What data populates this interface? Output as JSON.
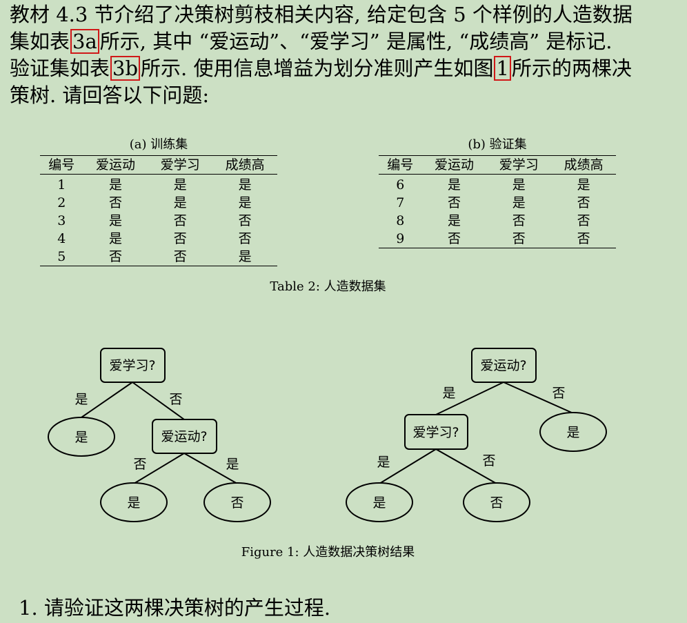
{
  "intro": {
    "line1": "教材 4.3 节介绍了决策树剪枝相关内容, 给定包含 5 个样例的人造数据",
    "line2_pre": "集如表",
    "ref_table_a": "3a",
    "line2_post": "所示, 其中 “爱运动”、“爱学习” 是属性, “成绩高” 是标记.",
    "line3_pre": "验证集如表",
    "ref_table_b": "3b",
    "line3_mid": "所示. 使用信息增益为划分准则产生如图",
    "ref_figure": "1",
    "line3_post": "所示的两棵决",
    "line4": "策树. 请回答以下问题:"
  },
  "table_a": {
    "caption": "(a) 训练集",
    "headers": [
      "编号",
      "爱运动",
      "爱学习",
      "成绩高"
    ],
    "rows": [
      [
        "1",
        "是",
        "是",
        "是"
      ],
      [
        "2",
        "否",
        "是",
        "是"
      ],
      [
        "3",
        "是",
        "否",
        "否"
      ],
      [
        "4",
        "是",
        "否",
        "否"
      ],
      [
        "5",
        "否",
        "否",
        "是"
      ]
    ]
  },
  "table_b": {
    "caption": "(b) 验证集",
    "headers": [
      "编号",
      "爱运动",
      "爱学习",
      "成绩高"
    ],
    "rows": [
      [
        "6",
        "是",
        "是",
        "是"
      ],
      [
        "7",
        "否",
        "是",
        "否"
      ],
      [
        "8",
        "是",
        "否",
        "否"
      ],
      [
        "9",
        "否",
        "否",
        "否"
      ]
    ]
  },
  "table_caption": "Table 2: 人造数据集",
  "tree_left": {
    "root": "爱学习?",
    "root_yes_edge": "是",
    "root_no_edge": "否",
    "root_yes_leaf": "是",
    "inner": "爱运动?",
    "inner_no_edge": "否",
    "inner_yes_edge": "是",
    "inner_no_leaf": "是",
    "inner_yes_leaf": "否"
  },
  "tree_right": {
    "root": "爱运动?",
    "root_yes_edge": "是",
    "root_no_edge": "否",
    "root_no_leaf": "是",
    "inner": "爱学习?",
    "inner_yes_edge": "是",
    "inner_no_edge": "否",
    "inner_yes_leaf": "是",
    "inner_no_leaf": "否"
  },
  "figure_caption": "Figure 1: 人造数据决策树结果",
  "question": "1. 请验证这两棵决策树的产生过程.",
  "colors": {
    "background": "#cce0c4",
    "ref_box": "#d01818"
  }
}
